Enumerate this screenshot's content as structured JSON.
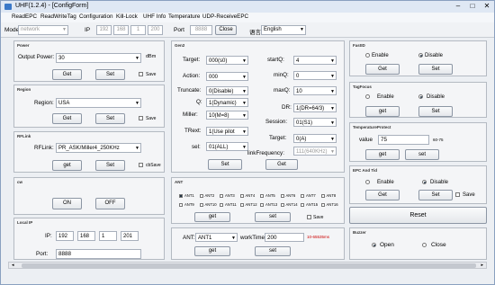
{
  "window": {
    "title": "UHF(1.2.4) - [ConfigForm]"
  },
  "menu": [
    "ReadEPC",
    "ReadWriteTag",
    "Configuration",
    "Kill-Lock",
    "UHF Info",
    "Temperature",
    "UDP-ReceiveEPC"
  ],
  "toolbar": {
    "mode_label": "Mode",
    "mode_value": "network",
    "ip_label": "IP",
    "ip": [
      "192",
      "168",
      "1",
      "200"
    ],
    "port_label": "Port",
    "port_value": "8888",
    "close_label": "Close",
    "lang_label": "语言",
    "lang_value": "English"
  },
  "power": {
    "title": "Power",
    "label": "Output Power:",
    "value": "30",
    "unit": "dBm",
    "get": "Get",
    "set": "Set",
    "save": "Save"
  },
  "region": {
    "title": "Region",
    "label": "Region:",
    "value": "USA",
    "get": "Get",
    "set": "Set",
    "save": "Save"
  },
  "rflink": {
    "title": "RFLink",
    "label": "RFLink:",
    "value": "PR_ASK/Miller4_250KHz",
    "get": "get",
    "set": "Set",
    "save": "cbSave"
  },
  "cw": {
    "title": "cw",
    "on": "ON",
    "off": "OFF"
  },
  "localip": {
    "title": "Local IP",
    "ip_label": "IP:",
    "ip": [
      "192",
      "168",
      "1",
      "201"
    ],
    "port_label": "Port:",
    "port_value": "8888"
  },
  "gen2": {
    "title": "Gen2",
    "target_label": "Target:",
    "target": "000(s0)",
    "action_label": "Action:",
    "action": "000",
    "truncate_label": "Truncate:",
    "truncate": "0(Disable)",
    "q_label": "Q:",
    "q": "1(Dynamic)",
    "miller_label": "Miller:",
    "miller": "10(M=8)",
    "trext_label": "TRext:",
    "trext": "1(Use pilot",
    "sel_label": "sel:",
    "sel": "01(ALL)",
    "startq_label": "startQ:",
    "startq": "4",
    "minq_label": "minQ:",
    "minq": "0",
    "maxq_label": "maxQ:",
    "maxq": "10",
    "dr_label": "DR:",
    "dr": "1(DR=64/3)",
    "session_label": "Session:",
    "session": "01(S1)",
    "target2_label": "Target:",
    "target2": "0(A)",
    "linkfreq_label": "linkFrequency:",
    "linkfreq": "111(640KHz)",
    "set": "Set",
    "get": "Get"
  },
  "ant": {
    "title": "ANT",
    "row1": [
      "ANT1",
      "ANT2",
      "ANT3",
      "ANT4",
      "ANT5",
      "ANT6",
      "ANT7",
      "ANT8"
    ],
    "row2": [
      "ANT9",
      "ANT10",
      "ANT11",
      "ANT12",
      "ANT13",
      "ANT14",
      "ANT15",
      "ANT16"
    ],
    "get": "get",
    "set": "set",
    "save": "Save",
    "ant_label": "ANT:",
    "ant_value": "ANT1",
    "worktime_label": "workTime:",
    "worktime_value": "200",
    "worktime_range": "10-65535ms"
  },
  "fastid": {
    "title": "FastID",
    "enable": "Enable",
    "disable": "Disable",
    "get": "Get",
    "set": "Set"
  },
  "tagfocus": {
    "title": "TagFocus",
    "enable": "Enable",
    "disable": "Disable",
    "get": "get",
    "set": "Set"
  },
  "temp": {
    "title": "TemperatureProtect",
    "label": "value",
    "value": "75",
    "range": "60-75",
    "get": "get",
    "set": "set"
  },
  "epc": {
    "title": "EPC And Tid",
    "enable": "Enable",
    "disable": "Disable",
    "get": "Get",
    "set": "Set",
    "save": "Save"
  },
  "reset": "Reset",
  "buzzer": {
    "title": "Buzzer",
    "open": "Open",
    "close": "Close"
  }
}
